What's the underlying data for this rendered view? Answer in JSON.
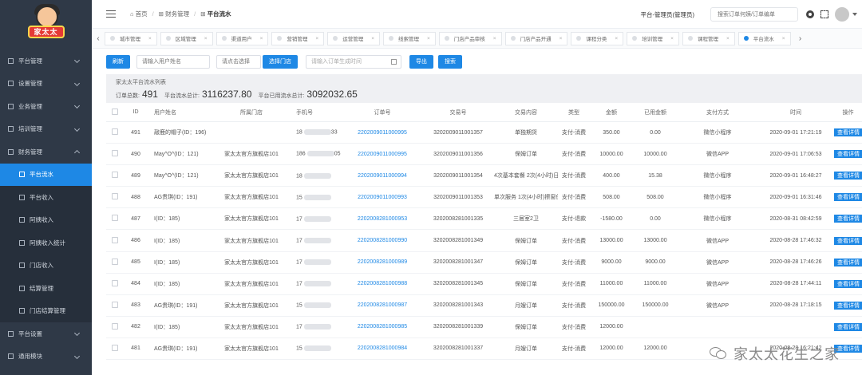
{
  "brand": {
    "logo_text": "家太太"
  },
  "sidebar": {
    "top_items": [
      {
        "label": "平台管理"
      },
      {
        "label": "设置管理"
      },
      {
        "label": "业务管理"
      },
      {
        "label": "培训管理"
      },
      {
        "label": "财务管理"
      }
    ],
    "sub_items": [
      {
        "label": "平台流水"
      },
      {
        "label": "平台收入"
      },
      {
        "label": "阿姨收入"
      },
      {
        "label": "阿姨收入统计"
      },
      {
        "label": "门店收入"
      },
      {
        "label": "结算管理"
      },
      {
        "label": "门店结算管理"
      }
    ],
    "bottom_items": [
      {
        "label": "平台设置"
      },
      {
        "label": "通用模块"
      }
    ]
  },
  "header": {
    "breadcrumb": {
      "home": "首页",
      "section": "财务管理",
      "current": "平台流水"
    },
    "role": "平台-管理员(管理员)",
    "search_placeholder": "搜索订单何姨/订单编单"
  },
  "tabs": [
    {
      "label": "城市管理"
    },
    {
      "label": "区域管理"
    },
    {
      "label": "渠道用户"
    },
    {
      "label": "营销管理"
    },
    {
      "label": "运营管理"
    },
    {
      "label": "线索管理"
    },
    {
      "label": "门店产品审核"
    },
    {
      "label": "门店产品开通"
    },
    {
      "label": "课程分类"
    },
    {
      "label": "培训管理"
    },
    {
      "label": "课程管理"
    },
    {
      "label": "平台流水"
    }
  ],
  "toolbar": {
    "refresh": "刷新",
    "name_placeholder": "请输入用户姓名",
    "store_placeholder": "请点击选择",
    "select_store": "选择门店",
    "date_placeholder": "请输入订单生成时间",
    "export": "导出",
    "search": "搜索"
  },
  "summary": {
    "title": "家太太平台流水列表",
    "order_count_label": "订单总数:",
    "order_count": "491",
    "total_label": "平台流水总计:",
    "total": "3116237.80",
    "used_label": "平台已用流水总计:",
    "used": "3092032.65"
  },
  "table": {
    "headers": [
      "ID",
      "用户姓名",
      "所属门店",
      "手机号",
      "订单号",
      "交易号",
      "交易内容",
      "类型",
      "金额",
      "已用金额",
      "支付方式",
      "时间",
      "操作"
    ],
    "action_label": "查看详情",
    "rows": [
      {
        "id": "491",
        "user": "敲鹿的帽子(ID：196)",
        "store": "",
        "phone": "18",
        "phone_tail": "33",
        "order": "2202009011000995",
        "trade": "3202009011001357",
        "content": "单独期货",
        "type": "支付-消费",
        "amount": "350.00",
        "used": "0.00",
        "pay": "微信小程序",
        "time": "2020-09-01 17:21:19"
      },
      {
        "id": "490",
        "user": "May^O^(ID：121)",
        "store": "家太太官方旗舰店101",
        "phone": "186",
        "phone_tail": "05",
        "order": "2202009011000995",
        "trade": "3202009011001356",
        "content": "保姆订单",
        "type": "支付-消费",
        "amount": "10000.00",
        "used": "10000.00",
        "pay": "微信APP",
        "time": "2020-09-01 17:06:53"
      },
      {
        "id": "489",
        "user": "May^O^(ID：121)",
        "store": "家太太官方旗舰店101",
        "phone": "18",
        "phone_tail": "",
        "order": "2202009011000994",
        "trade": "3202009011001354",
        "content": "4次基本套餐 2次(4小时)日常保洁",
        "type": "支付-消费",
        "amount": "400.00",
        "used": "15.38",
        "pay": "微信小程序",
        "time": "2020-09-01 16:48:27"
      },
      {
        "id": "488",
        "user": "AG贵琪(ID：191)",
        "store": "家太太官方旗舰店101",
        "phone": "15",
        "phone_tail": "",
        "order": "2202009011000993",
        "trade": "3202009011001353",
        "content": "单次服务 1次(4小时)擦窗保洁",
        "type": "支付-消费",
        "amount": "508.00",
        "used": "508.00",
        "pay": "微信小程序",
        "time": "2020-09-01 16:31:46"
      },
      {
        "id": "487",
        "user": "I(ID：185)",
        "store": "家太太官方旗舰店101",
        "phone": "17",
        "phone_tail": "",
        "order": "2202008281000953",
        "trade": "3202008281001335",
        "content": "三居室2卫",
        "type": "支付-退款",
        "amount": "-1580.00",
        "used": "0.00",
        "pay": "微信小程序",
        "time": "2020-08-31 08:42:59"
      },
      {
        "id": "486",
        "user": "I(ID：185)",
        "store": "家太太官方旗舰店101",
        "phone": "17",
        "phone_tail": "",
        "order": "2202008281000990",
        "trade": "3202008281001349",
        "content": "保姆订单",
        "type": "支付-消费",
        "amount": "13000.00",
        "used": "13000.00",
        "pay": "微信APP",
        "time": "2020-08-28 17:46:32"
      },
      {
        "id": "485",
        "user": "I(ID：185)",
        "store": "家太太官方旗舰店101",
        "phone": "17",
        "phone_tail": "",
        "order": "2202008281000989",
        "trade": "3202008281001347",
        "content": "保姆订单",
        "type": "支付-消费",
        "amount": "9000.00",
        "used": "9000.00",
        "pay": "微信APP",
        "time": "2020-08-28 17:46:26"
      },
      {
        "id": "484",
        "user": "I(ID：185)",
        "store": "家太太官方旗舰店101",
        "phone": "17",
        "phone_tail": "",
        "order": "2202008281000988",
        "trade": "3202008281001345",
        "content": "保姆订单",
        "type": "支付-消费",
        "amount": "11000.00",
        "used": "11000.00",
        "pay": "微信APP",
        "time": "2020-08-28 17:44:11"
      },
      {
        "id": "483",
        "user": "AG贵琪(ID：191)",
        "store": "家太太官方旗舰店101",
        "phone": "15",
        "phone_tail": "",
        "order": "2202008281000987",
        "trade": "3202008281001343",
        "content": "月嫂订单",
        "type": "支付-消费",
        "amount": "150000.00",
        "used": "150000.00",
        "pay": "微信APP",
        "time": "2020-08-28 17:18:15"
      },
      {
        "id": "482",
        "user": "I(ID：185)",
        "store": "家太太官方旗舰店101",
        "phone": "17",
        "phone_tail": "",
        "order": "2202008281000985",
        "trade": "3202008281001339",
        "content": "保姆订单",
        "type": "支付-消费",
        "amount": "12000.00",
        "used": "",
        "pay": "",
        "time": ""
      },
      {
        "id": "481",
        "user": "AG贵琪(ID：191)",
        "store": "家太太官方旗舰店101",
        "phone": "15",
        "phone_tail": "",
        "order": "2202008281000984",
        "trade": "3202008281001337",
        "content": "月嫂订单",
        "type": "支付-消费",
        "amount": "12000.00",
        "used": "12000.00",
        "pay": "",
        "time": "2020-08-28 16:21:42"
      }
    ]
  },
  "watermark": {
    "text": "家太太花生之家"
  },
  "colors": {
    "sidebar_bg": "#2f3947",
    "accent": "#1e88e5"
  },
  "icons": [
    "menu-icon",
    "home-icon",
    "grid-icon",
    "settings-gear-icon",
    "fullscreen-icon",
    "avatar-icon",
    "calendar-icon",
    "chevron-down-icon",
    "wechat-icon"
  ]
}
